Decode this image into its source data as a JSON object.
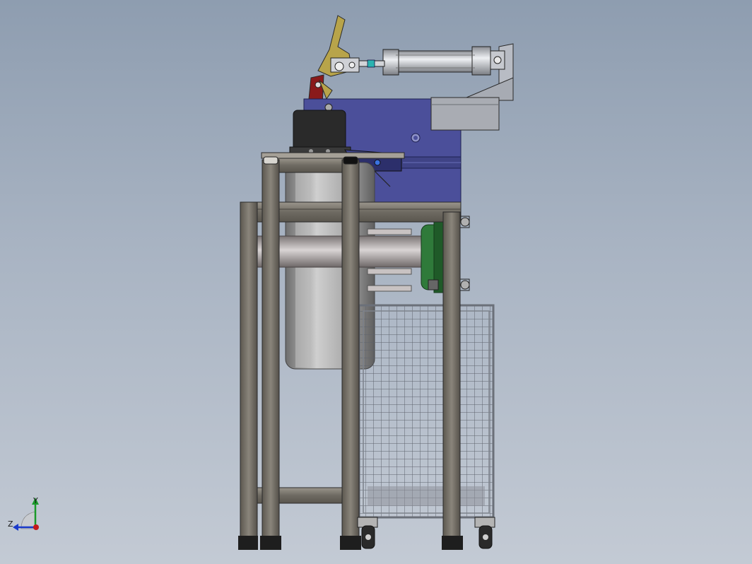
{
  "viewport": {
    "background_top": "#8e9db0",
    "background_bottom": "#c3cad4"
  },
  "triad": {
    "y_label": "Y",
    "z_label": "Z",
    "y_color": "#1a9a2a",
    "z_color": "#1a3acb",
    "x_color": "#c41a1a"
  },
  "colors": {
    "frame_steel": "#6f6a62",
    "frame_dark": "#3a3832",
    "housing_blue": "#4b4f9a",
    "motor_black": "#2a2a2a",
    "cylinder_silver": "#c9ccd2",
    "flange_green": "#2f7a3a",
    "lever_yellow": "#b8a44a",
    "arm_red": "#8a1a1a",
    "wheel_grey": "#a9a9a9",
    "cage_grey": "#8a8e96"
  }
}
